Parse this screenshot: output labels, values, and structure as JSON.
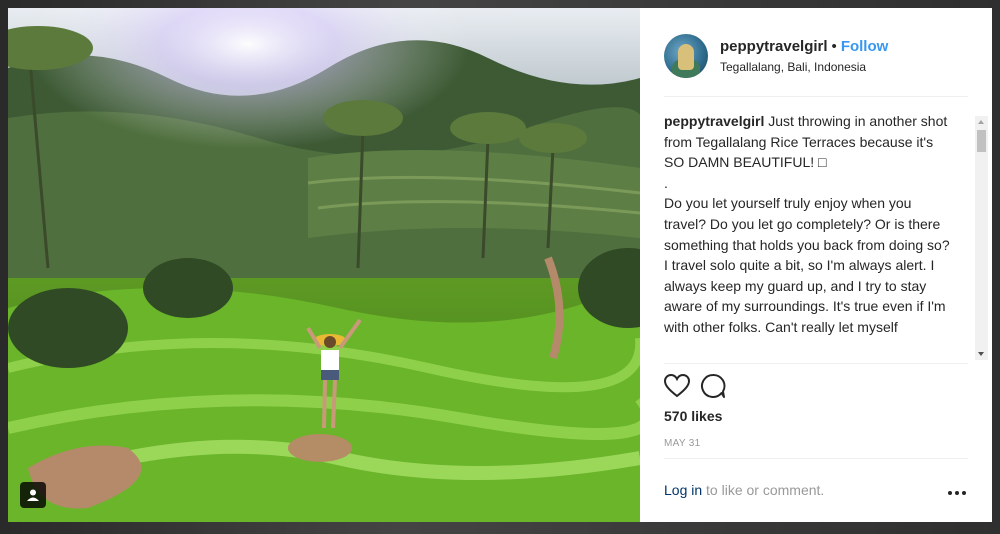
{
  "post": {
    "username": "peppytravelgirl",
    "separator": "•",
    "follow_label": "Follow",
    "location": "Tegallalang, Bali, Indonesia",
    "caption_username": "peppytravelgirl",
    "caption_text": " Just throwing in another shot from Tegallalang Rice Terraces because it's SO DAMN BEAUTIFUL! □\n.\nDo you let yourself truly enjoy when you travel? Do you let go completely? Or is there something that holds you back from doing so?\nI travel solo quite a bit, so I'm always alert. I always keep my guard up, and I try to stay aware of my surroundings. It's true even if I'm with other folks. Can't really let myself",
    "likes": "570 likes",
    "date": "MAY 31",
    "login_link": "Log in",
    "login_suffix": " to like or comment."
  },
  "icons": {
    "like": "heart-icon",
    "comment": "comment-icon",
    "more": "more-options-icon",
    "user_tag": "user-tag-icon"
  },
  "colors": {
    "follow": "#3897f0",
    "link": "#003569",
    "text": "#262626",
    "muted": "#999999"
  }
}
